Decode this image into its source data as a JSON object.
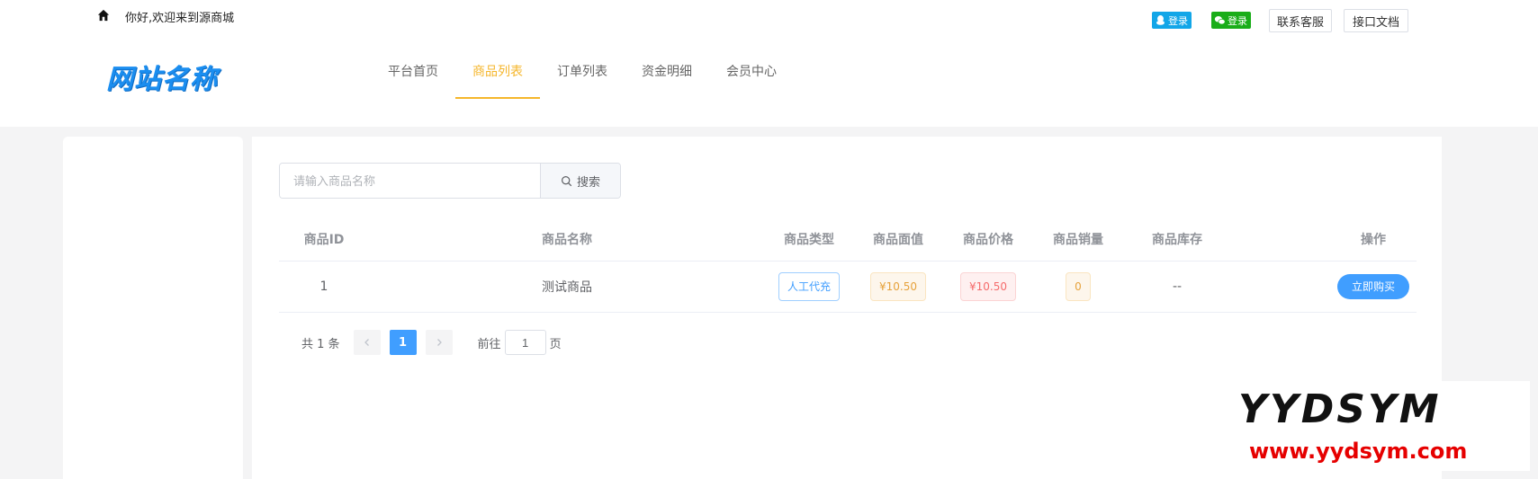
{
  "topbar": {
    "welcome": "你好,欢迎来到源商城",
    "qq_login": "登录",
    "wechat_login": "登录",
    "service": "联系客服",
    "api_docs": "接口文档"
  },
  "logo": {
    "text": "网站名称",
    "color": "#1b8ef0"
  },
  "nav": {
    "items": [
      {
        "label": "平台首页",
        "active": false
      },
      {
        "label": "商品列表",
        "active": true
      },
      {
        "label": "订单列表",
        "active": false
      },
      {
        "label": "资金明细",
        "active": false
      },
      {
        "label": "会员中心",
        "active": false
      }
    ],
    "active_color": "#f5b62b"
  },
  "search": {
    "placeholder": "请输入商品名称",
    "value": "",
    "button_label": "搜索",
    "icon": "search-icon"
  },
  "table": {
    "headers": [
      "商品ID",
      "商品名称",
      "商品类型",
      "商品面值",
      "商品价格",
      "商品销量",
      "商品库存",
      "操作"
    ],
    "rows": [
      {
        "id": "1",
        "name": "测试商品",
        "type": "人工代充",
        "face_value": "¥10.50",
        "price": "¥10.50",
        "sales": "0",
        "stock": "--",
        "action": "立即购买"
      }
    ]
  },
  "pagination": {
    "total": "共 1 条",
    "current": "1",
    "goto_prefix": "前往",
    "goto_value": "1",
    "goto_suffix": "页"
  },
  "watermark": {
    "brand": "YYDSYM",
    "url": "www.yydsym.com"
  },
  "colors": {
    "primary": "#409eff",
    "accent": "#f5b62b",
    "qq": "#12a6e8",
    "wechat": "#1aad19"
  }
}
